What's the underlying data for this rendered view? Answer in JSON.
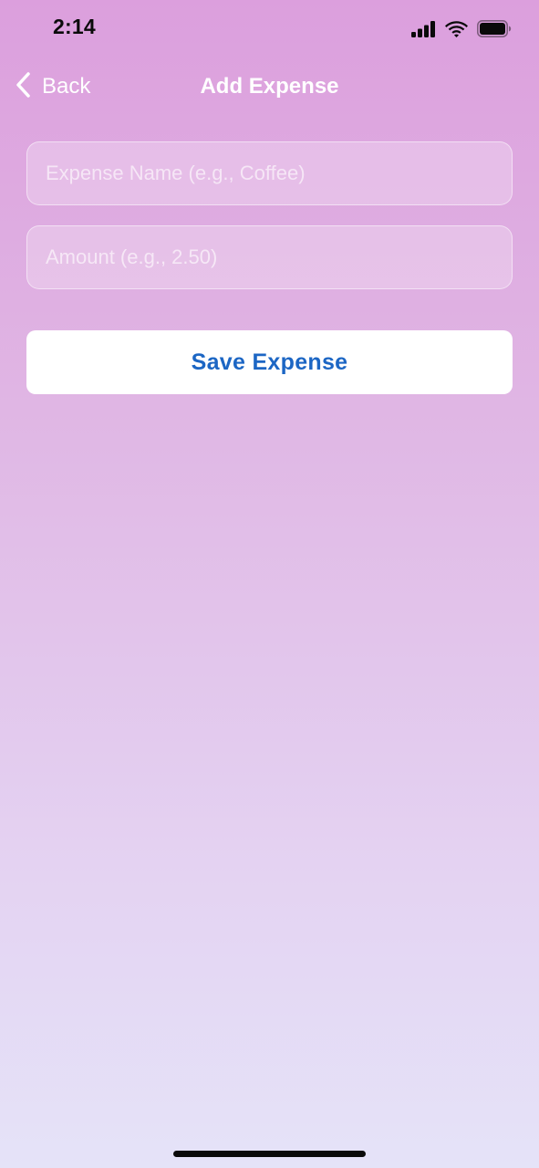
{
  "status_bar": {
    "time": "2:14",
    "icons": [
      "cellular-signal-icon",
      "wifi-icon",
      "battery-icon"
    ]
  },
  "nav": {
    "back_label": "Back",
    "back_icon": "chevron-left-icon",
    "title": "Add Expense"
  },
  "form": {
    "name_field": {
      "value": "",
      "placeholder": "Expense Name (e.g., Coffee)"
    },
    "amount_field": {
      "value": "",
      "placeholder": "Amount (e.g., 2.50)"
    },
    "save_label": "Save Expense"
  },
  "colors": {
    "gradient_top": "#dc9fdd",
    "gradient_bottom": "#e5e3f8",
    "button_text": "#1c66c4",
    "button_bg": "#ffffff"
  }
}
